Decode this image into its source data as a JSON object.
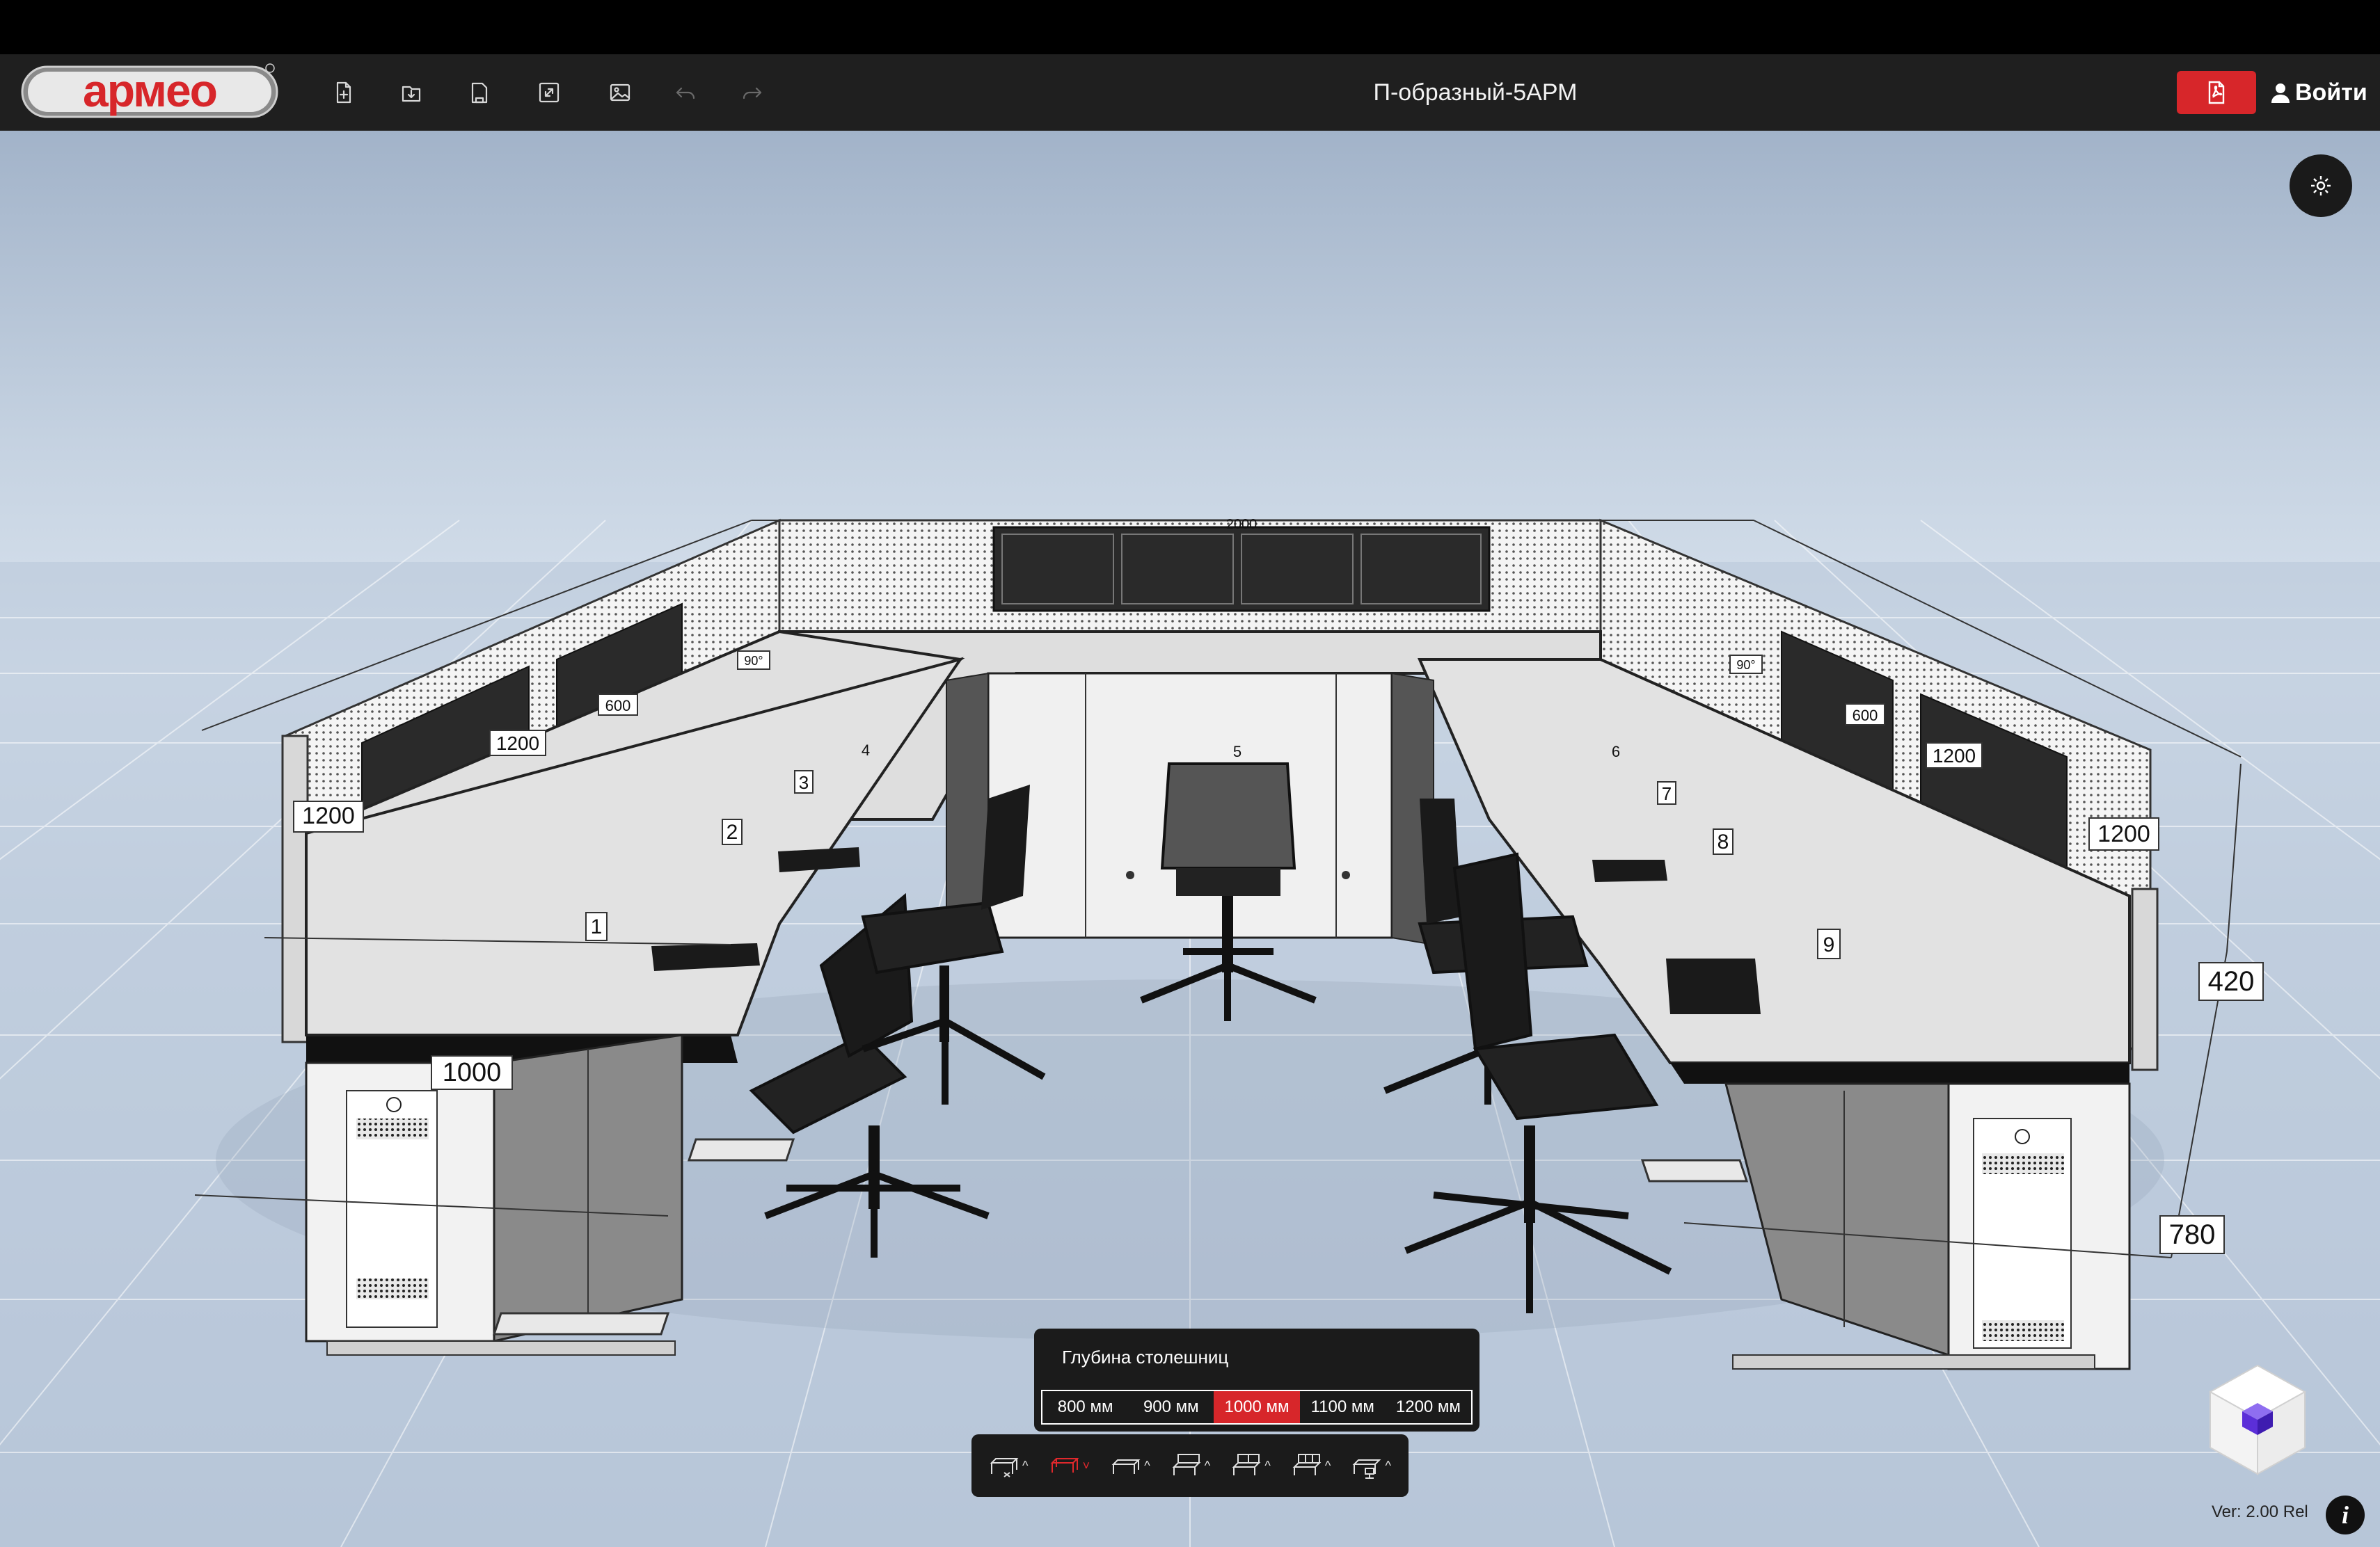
{
  "app": {
    "logo_text": "армео",
    "document_title": "П-образный-5АРМ",
    "login_label": "Войти",
    "version": "Ver: 2.00 Rel"
  },
  "toolbar": {
    "tools": [
      {
        "name": "new-file-icon",
        "enabled": true
      },
      {
        "name": "open-file-icon",
        "enabled": true
      },
      {
        "name": "save-file-icon",
        "enabled": true
      },
      {
        "name": "expand-icon",
        "enabled": true
      },
      {
        "name": "image-icon",
        "enabled": true
      },
      {
        "name": "undo-icon",
        "enabled": false
      },
      {
        "name": "redo-icon",
        "enabled": false
      }
    ],
    "pdf_icon": "pdf-icon",
    "accent_color": "#d7262a"
  },
  "depth_panel": {
    "title": "Глубина столешниц",
    "options": [
      "800 мм",
      "900 мм",
      "1000 мм",
      "1100 мм",
      "1200 мм"
    ],
    "selected": "1000 мм"
  },
  "layout_bar": {
    "items": [
      {
        "name": "layout-single-icon",
        "active": false
      },
      {
        "name": "layout-l-shaped-icon",
        "active": true
      },
      {
        "name": "layout-desk-icon",
        "active": false
      },
      {
        "name": "layout-panel-icon",
        "active": false
      },
      {
        "name": "layout-panel-double-icon",
        "active": false
      },
      {
        "name": "layout-panel-triple-icon",
        "active": false
      },
      {
        "name": "layout-chair-icon",
        "active": false
      }
    ]
  },
  "scene": {
    "dimensions": {
      "left_back_1": "1200",
      "left_back_2": "1200",
      "left_back_3": "600",
      "left_corner": "90°",
      "top_center": "2000",
      "right_corner": "90°",
      "right_back_1": "600",
      "right_back_2": "1200",
      "right_back_3": "1200",
      "front_depth": "1000",
      "panel_height": "420",
      "desk_height": "780"
    },
    "markers": [
      "1",
      "2",
      "3",
      "4",
      "5",
      "6",
      "7",
      "8",
      "9"
    ]
  }
}
